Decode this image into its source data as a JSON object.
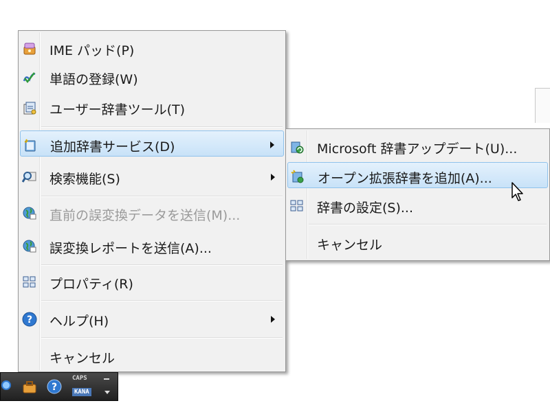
{
  "main_menu": {
    "items": [
      {
        "label": "IME パッド(P)",
        "icon": "ime-pad-icon"
      },
      {
        "label": "単語の登録(W)",
        "icon": "word-register-icon"
      },
      {
        "label": "ユーザー辞書ツール(T)",
        "icon": "user-dictionary-tool-icon"
      },
      {
        "label": "追加辞書サービス(D)",
        "icon": "additional-dictionary-icon",
        "submenu": true,
        "highlighted": true
      },
      {
        "label": "検索機能(S)",
        "icon": "search-function-icon",
        "submenu": true
      },
      {
        "label": "直前の誤変換データを送信(M)...",
        "icon": "send-data-globe-icon",
        "disabled": true
      },
      {
        "label": "誤変換レポートを送信(A)...",
        "icon": "send-report-globe-icon"
      },
      {
        "label": "プロパティ(R)",
        "icon": "properties-icon"
      },
      {
        "label": "ヘルプ(H)",
        "icon": "help-icon",
        "submenu": true
      },
      {
        "label": "キャンセル"
      }
    ]
  },
  "submenu": {
    "items": [
      {
        "label": "Microsoft 辞書アップデート(U)...",
        "icon": "dictionary-update-icon"
      },
      {
        "label": "オープン拡張辞書を追加(A)...",
        "icon": "open-extension-dictionary-icon",
        "highlighted": true
      },
      {
        "label": "辞書の設定(S)...",
        "icon": "dictionary-settings-icon"
      },
      {
        "label": "キャンセル"
      }
    ]
  },
  "language_bar": {
    "caps": "CAPS",
    "kana": "KANA"
  },
  "colors": {
    "highlight": "#c8e2f8",
    "highlight_border": "#8fc2ec",
    "menu_bg": "#f1f1f1",
    "disabled_text": "#9a9a9a"
  }
}
